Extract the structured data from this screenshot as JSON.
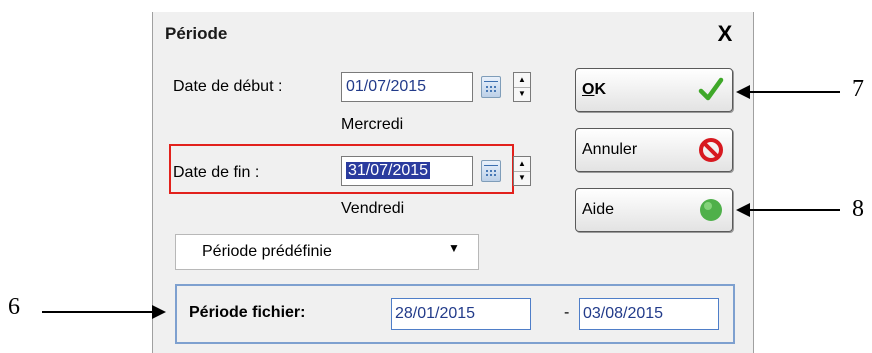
{
  "dialog": {
    "title": "Période",
    "close_label": "X"
  },
  "date_debut": {
    "label": "Date de début :",
    "value": "01/07/2015",
    "weekday": "Mercredi"
  },
  "date_fin": {
    "label": "Date de fin :",
    "value": "31/07/2015",
    "weekday": "Vendredi"
  },
  "buttons": {
    "ok_prefix": "O",
    "ok_rest": "K",
    "cancel": "Annuler",
    "help": "Aide"
  },
  "period_select": {
    "selected": "Période prédéfinie"
  },
  "period_file": {
    "label": "Période fichier:",
    "start": "28/01/2015",
    "separator": "-",
    "end": "03/08/2015"
  },
  "callouts": {
    "six": "6",
    "seven": "7",
    "eight": "8"
  },
  "colors": {
    "highlight_box": "#e2211c",
    "selection": "#2a3b9e",
    "ok_check": "#3fa829",
    "cancel_icon": "#d71920",
    "help_icon": "#4fb04a",
    "group_border": "#7ea0cf"
  },
  "icons": [
    "close-icon",
    "calendar-icon",
    "spin-up-icon",
    "spin-down-icon",
    "checkmark-icon",
    "no-entry-icon",
    "help-icon",
    "dropdown-arrow-icon"
  ]
}
